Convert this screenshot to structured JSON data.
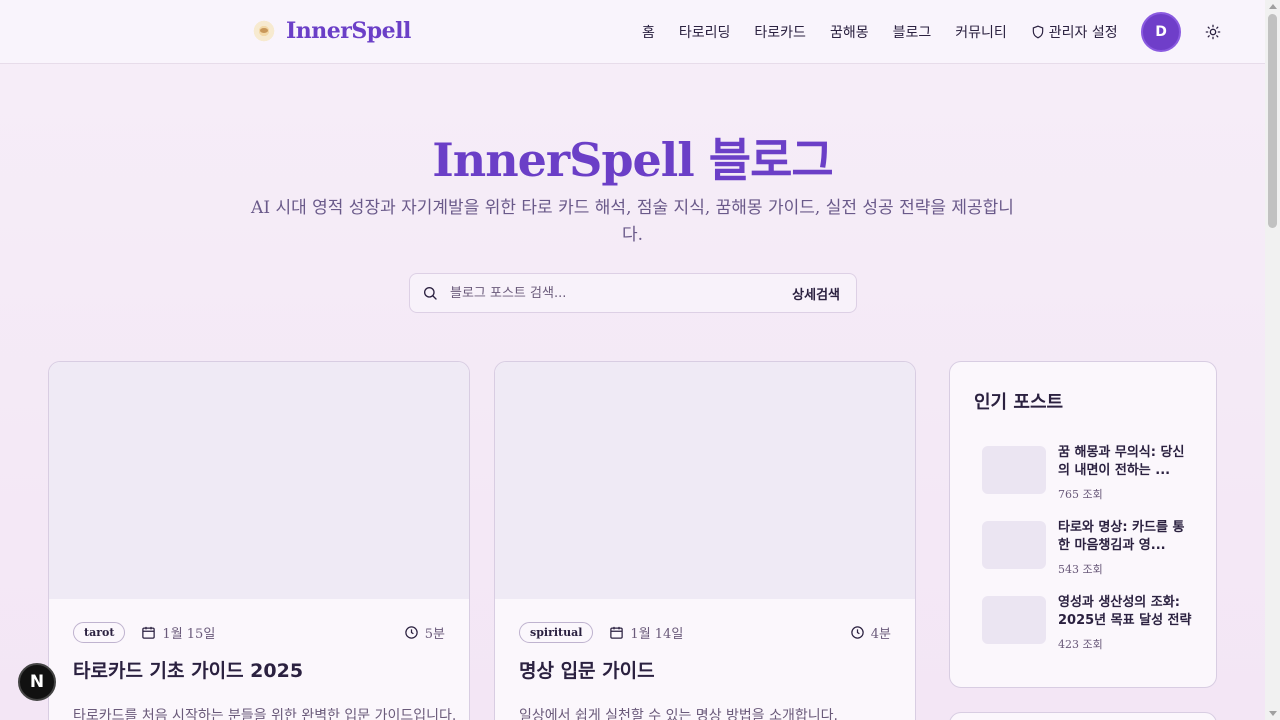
{
  "header": {
    "logo_text": "InnerSpell",
    "nav": [
      {
        "label": "홈"
      },
      {
        "label": "타로리딩"
      },
      {
        "label": "타로카드"
      },
      {
        "label": "꿈해몽"
      },
      {
        "label": "블로그"
      },
      {
        "label": "커뮤니티"
      },
      {
        "label": "관리자 설정"
      }
    ],
    "avatar_initial": "D"
  },
  "hero": {
    "title": "InnerSpell 블로그",
    "subtitle": "AI 시대 영적 성장과 자기계발을 위한 타로 카드 해석, 점술 지식, 꿈해몽 가이드, 실전 성공 전략을 제공합니다."
  },
  "search": {
    "placeholder": "블로그 포스트 검색...",
    "advanced_label": "상세검색"
  },
  "posts": [
    {
      "tag": "tarot",
      "date": "1월 15일",
      "read_time": "5분",
      "title": "타로카드 기초 가이드 2025",
      "excerpt": "타로카드를 처음 시작하는 분들을 위한 완벽한 입문 가이드입니다."
    },
    {
      "tag": "spiritual",
      "date": "1월 14일",
      "read_time": "4분",
      "title": "명상 입문 가이드",
      "excerpt": "일상에서 쉽게 실천할 수 있는 명상 방법을 소개합니다."
    }
  ],
  "sidebar": {
    "title": "인기 포스트",
    "popular": [
      {
        "title": "꿈 해몽과 무의식: 당신의 내면이 전하는 ...",
        "views": "765 조회"
      },
      {
        "title": "타로와 명상: 카드를 통한 마음챙김과 영...",
        "views": "543 조회"
      },
      {
        "title": "영성과 생산성의 조화: 2025년 목표 달성 전략",
        "views": "423 조회"
      }
    ]
  },
  "next_badge": "N",
  "colors": {
    "accent": "#6b3fc7",
    "background": "#f6eef8",
    "card": "#fbf7fc"
  }
}
